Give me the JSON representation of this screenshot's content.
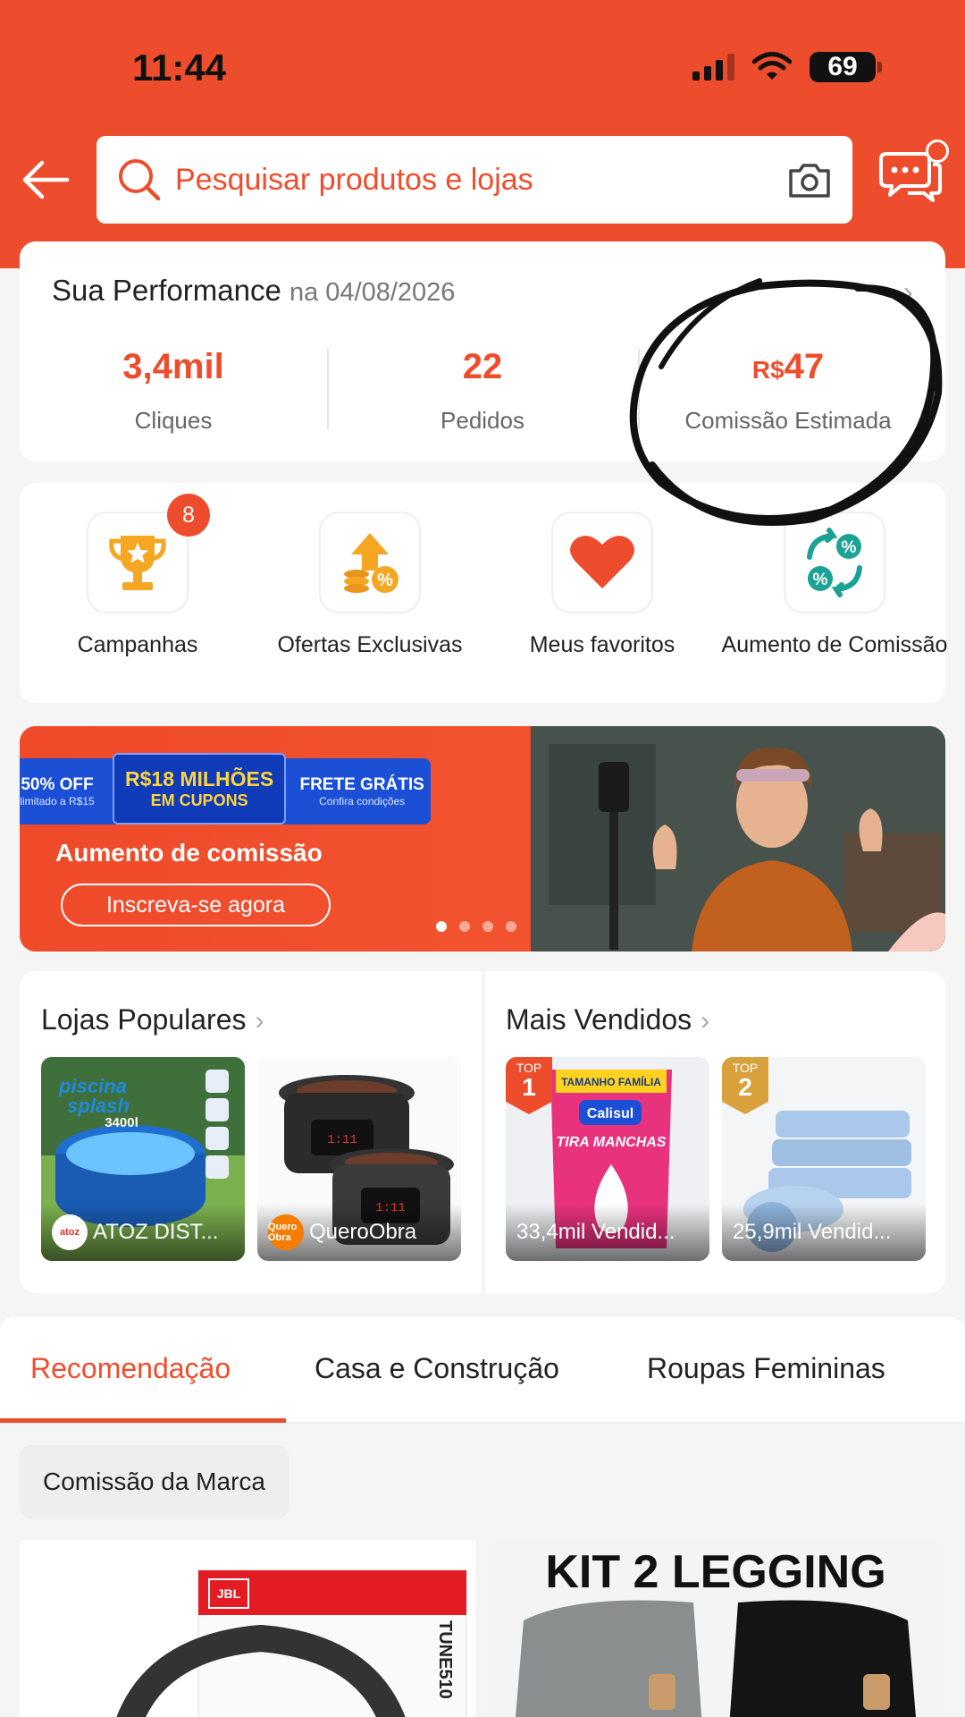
{
  "status": {
    "time": "11:44",
    "battery": "69"
  },
  "search": {
    "placeholder": "Pesquisar produtos e lojas"
  },
  "performance": {
    "title": "Sua Performance",
    "date": "na 04/08/2026",
    "metrics": [
      {
        "value": "3,4mil",
        "label": "Cliques"
      },
      {
        "value": "22",
        "label": "Pedidos"
      },
      {
        "currency": "R$",
        "value": "47",
        "label": "Comissão Estimada"
      }
    ]
  },
  "quick_actions": [
    {
      "label": "Campanhas",
      "badge": "8",
      "icon": "trophy-icon"
    },
    {
      "label": "Ofertas Exclusivas",
      "icon": "coins-percent-icon"
    },
    {
      "label": "Meus favoritos",
      "icon": "heart-icon"
    },
    {
      "label": "Aumento de Comissão",
      "icon": "percent-exchange-icon"
    }
  ],
  "banner": {
    "pill_left_big": "50% OFF",
    "pill_left_small": "limitado a R$15",
    "pill_mid_line1": "R$18 MILHÕES",
    "pill_mid_line2": "EM CUPONS",
    "pill_right_big": "FRETE GRÁTIS",
    "pill_right_small": "Confira condições",
    "title": "Aumento de comissão",
    "cta": "Inscreva-se agora"
  },
  "popular_stores": {
    "title": "Lojas Populares",
    "items": [
      {
        "name": "ATOZ DIST...",
        "logo": "atoz",
        "image_text": "piscina splash 3400l"
      },
      {
        "name": "QueroObra",
        "logo": "Quero Obra"
      }
    ]
  },
  "best_sellers": {
    "title": "Mais Vendidos",
    "items": [
      {
        "rank_label": "TOP",
        "rank": "1",
        "sold": "33,4mil Vendid...",
        "brand": "Calisul",
        "product_text": "TIRA MANCHAS",
        "package_top": "TAMANHO FAMÍLIA"
      },
      {
        "rank_label": "TOP",
        "rank": "2",
        "sold": "25,9mil Vendid..."
      }
    ]
  },
  "tabs": [
    "Recomendação",
    "Casa e Construção",
    "Roupas Femininas"
  ],
  "filter_chip": "Comissão da Marca",
  "products": [
    {
      "brand_text": "JBL",
      "model_text": "TUNE510"
    },
    {
      "title": "KIT 2 LEGGING"
    }
  ],
  "colors": {
    "accent": "#ee4d2d",
    "banner_blue": "#1a4fd6",
    "coupon_yellow": "#ffd43b"
  }
}
